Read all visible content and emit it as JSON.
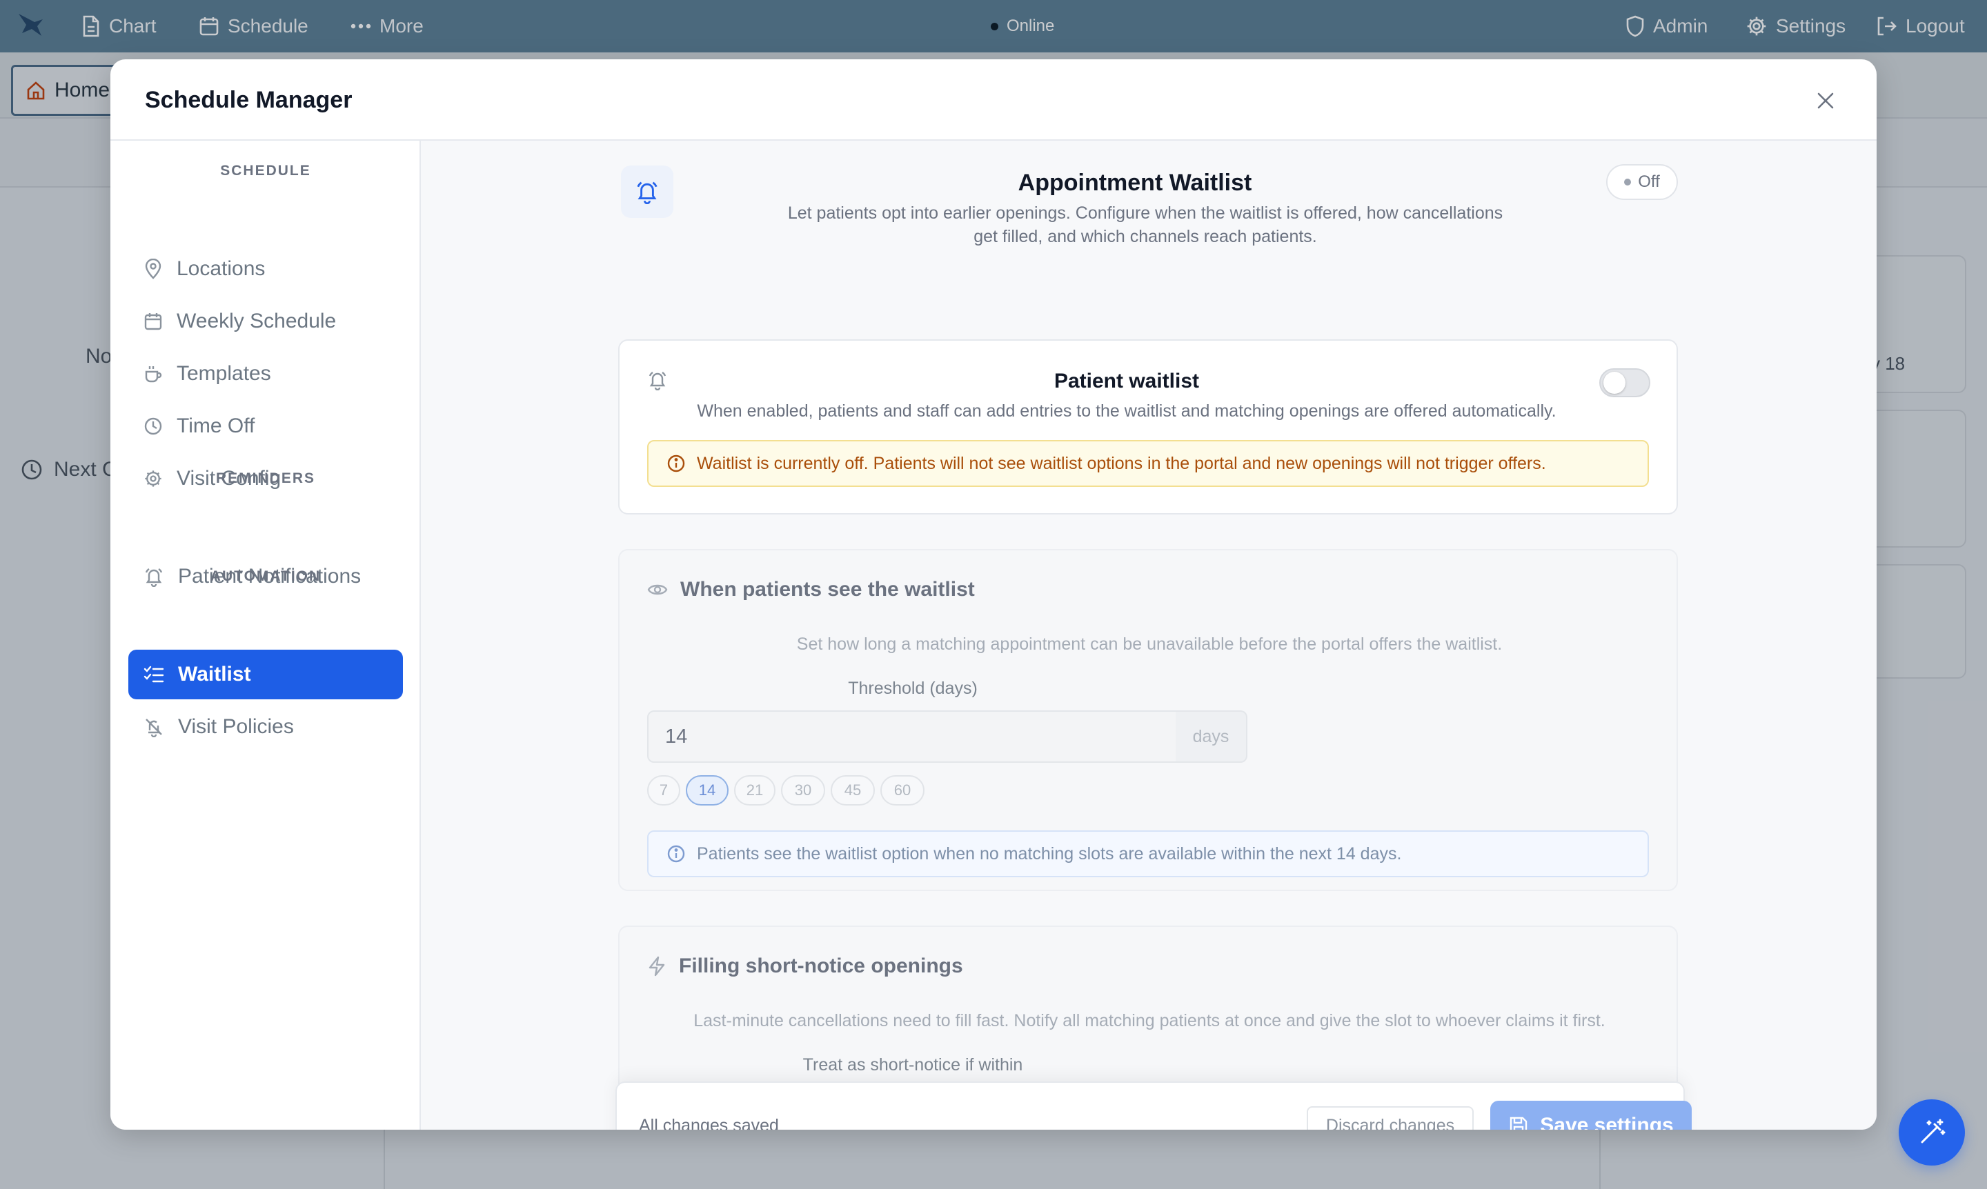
{
  "topbar": {
    "nav": [
      {
        "label": "Chart",
        "icon": "document-icon"
      },
      {
        "label": "Schedule",
        "icon": "calendar-icon"
      },
      {
        "label": "More",
        "icon": "more-dots-icon"
      }
    ],
    "status": "Online",
    "right": [
      {
        "label": "Admin",
        "icon": "shield-icon"
      },
      {
        "label": "Settings",
        "icon": "gear-icon"
      },
      {
        "label": "Logout",
        "icon": "logout-icon"
      }
    ]
  },
  "background": {
    "home_tab": "Home",
    "partial_no": "No",
    "partial_next": "Next C",
    "partial_date": "y 18"
  },
  "modal": {
    "title": "Schedule Manager",
    "sidebar": {
      "sections": [
        {
          "title": "SCHEDULE",
          "items": [
            {
              "label": "Locations",
              "icon": "map-pin-icon"
            },
            {
              "label": "Weekly Schedule",
              "icon": "calendar-icon"
            },
            {
              "label": "Templates",
              "icon": "coffee-cup-icon"
            },
            {
              "label": "Time Off",
              "icon": "clock-icon"
            },
            {
              "label": "Visit Config",
              "icon": "gear-icon"
            }
          ]
        },
        {
          "title": "REMINDERS",
          "items": [
            {
              "label": "Patient Notifications",
              "icon": "bell-ringing-icon"
            }
          ]
        },
        {
          "title": "AUTOMATION",
          "items": [
            {
              "label": "Waitlist",
              "icon": "list-checks-icon",
              "active": true
            },
            {
              "label": "Visit Policies",
              "icon": "bell-off-icon"
            }
          ]
        }
      ]
    },
    "content": {
      "title": "Appointment Waitlist",
      "description": "Let patients opt into earlier openings. Configure when the waitlist is offered, how cancellations get filled, and which channels reach patients.",
      "status_badge": "Off",
      "patient_waitlist": {
        "title": "Patient waitlist",
        "description": "When enabled, patients and staff can add entries to the waitlist and matching openings are offered automatically.",
        "enabled": false,
        "warning": "Waitlist is currently off. Patients will not see waitlist options in the portal and new openings will not trigger offers."
      },
      "visibility": {
        "title": "When patients see the waitlist",
        "description": "Set how long a matching appointment can be unavailable before the portal offers the waitlist.",
        "threshold_label": "Threshold (days)",
        "threshold_value": "14",
        "threshold_unit": "days",
        "presets": [
          "7",
          "14",
          "21",
          "30",
          "45",
          "60"
        ],
        "selected_preset": "14",
        "info": "Patients see the waitlist option when no matching slots are available within the next 14 days."
      },
      "short_notice": {
        "title": "Filling short-notice openings",
        "description": "Last-minute cancellations need to fill fast. Notify all matching patients at once and give the slot to whoever claims it first.",
        "field_label": "Treat as short-notice if within"
      }
    },
    "footer": {
      "status": "All changes saved",
      "discard_label": "Discard changes",
      "save_label": "Save settings"
    }
  },
  "colors": {
    "topbar": "#5d8196",
    "accent": "#1e5ee6",
    "save_button_disabled": "#8cb0f2",
    "warning_text": "#a94e0a",
    "warning_bg": "#fefbe8"
  }
}
